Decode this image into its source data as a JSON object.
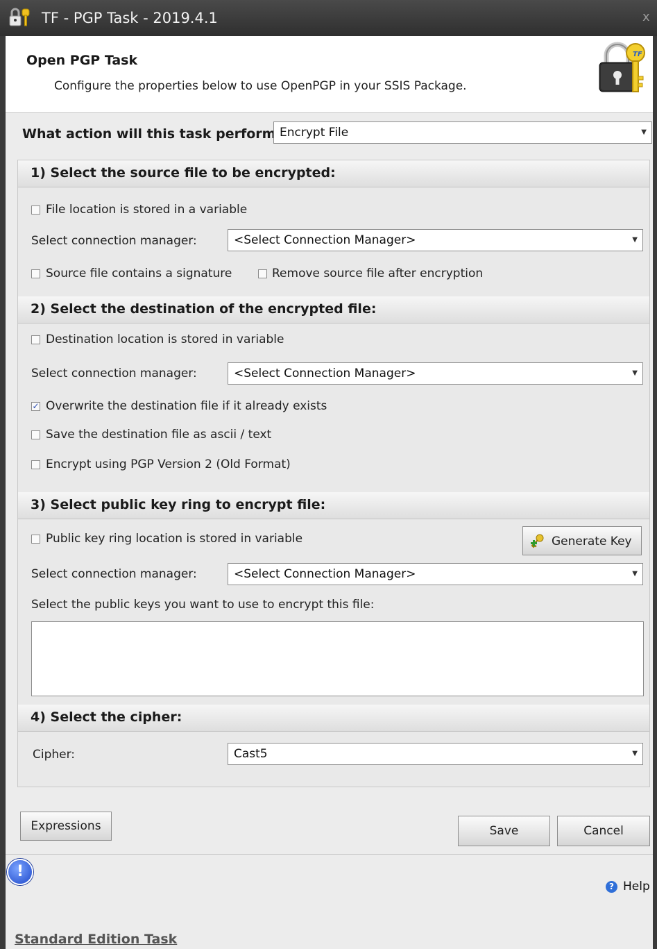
{
  "window": {
    "title": "TF - PGP Task - 2019.4.1",
    "close": "x"
  },
  "header": {
    "title": "Open PGP Task",
    "subtitle": "Configure the properties below to use OpenPGP in your SSIS Package."
  },
  "action": {
    "label": "What action will this task perform?",
    "value": "Encrypt File"
  },
  "section1": {
    "title": "1) Select the source file to be encrypted:",
    "var_checkbox": "File location is stored in a variable",
    "conn_label": "Select connection manager:",
    "conn_value": "<Select Connection Manager>",
    "signature_checkbox": "Source file contains a signature",
    "remove_checkbox": "Remove source file after encryption"
  },
  "section2": {
    "title": "2) Select the destination of the encrypted file:",
    "var_checkbox": "Destination location is stored in variable",
    "conn_label": "Select connection manager:",
    "conn_value": "<Select Connection Manager>",
    "overwrite_checkbox": "Overwrite the destination file if it already exists",
    "ascii_checkbox": "Save the destination file as ascii / text",
    "pgp2_checkbox": "Encrypt using PGP Version 2 (Old Format)",
    "checkmark": "✓"
  },
  "section3": {
    "title": "3) Select public key ring to encrypt file:",
    "var_checkbox": "Public key ring location is stored in variable",
    "generate_key": "Generate Key",
    "conn_label": "Select connection manager:",
    "conn_value": "<Select Connection Manager>",
    "keys_label": "Select the public keys you want to use to encrypt this file:"
  },
  "section4": {
    "title": "4) Select the cipher:",
    "cipher_label": "Cipher:",
    "cipher_value": "Cast5"
  },
  "buttons": {
    "expressions": "Expressions",
    "save": "Save",
    "cancel": "Cancel"
  },
  "footer": {
    "help": "Help",
    "edition_link": "Standard Edition Task",
    "info_glyph": "!",
    "help_glyph": "?"
  },
  "icons": {
    "app": "padlock-key-icon",
    "header": "lock-key-icon",
    "generate_key": "key-add-icon",
    "info": "info-icon",
    "help": "help-icon",
    "dropdown": "▼"
  }
}
